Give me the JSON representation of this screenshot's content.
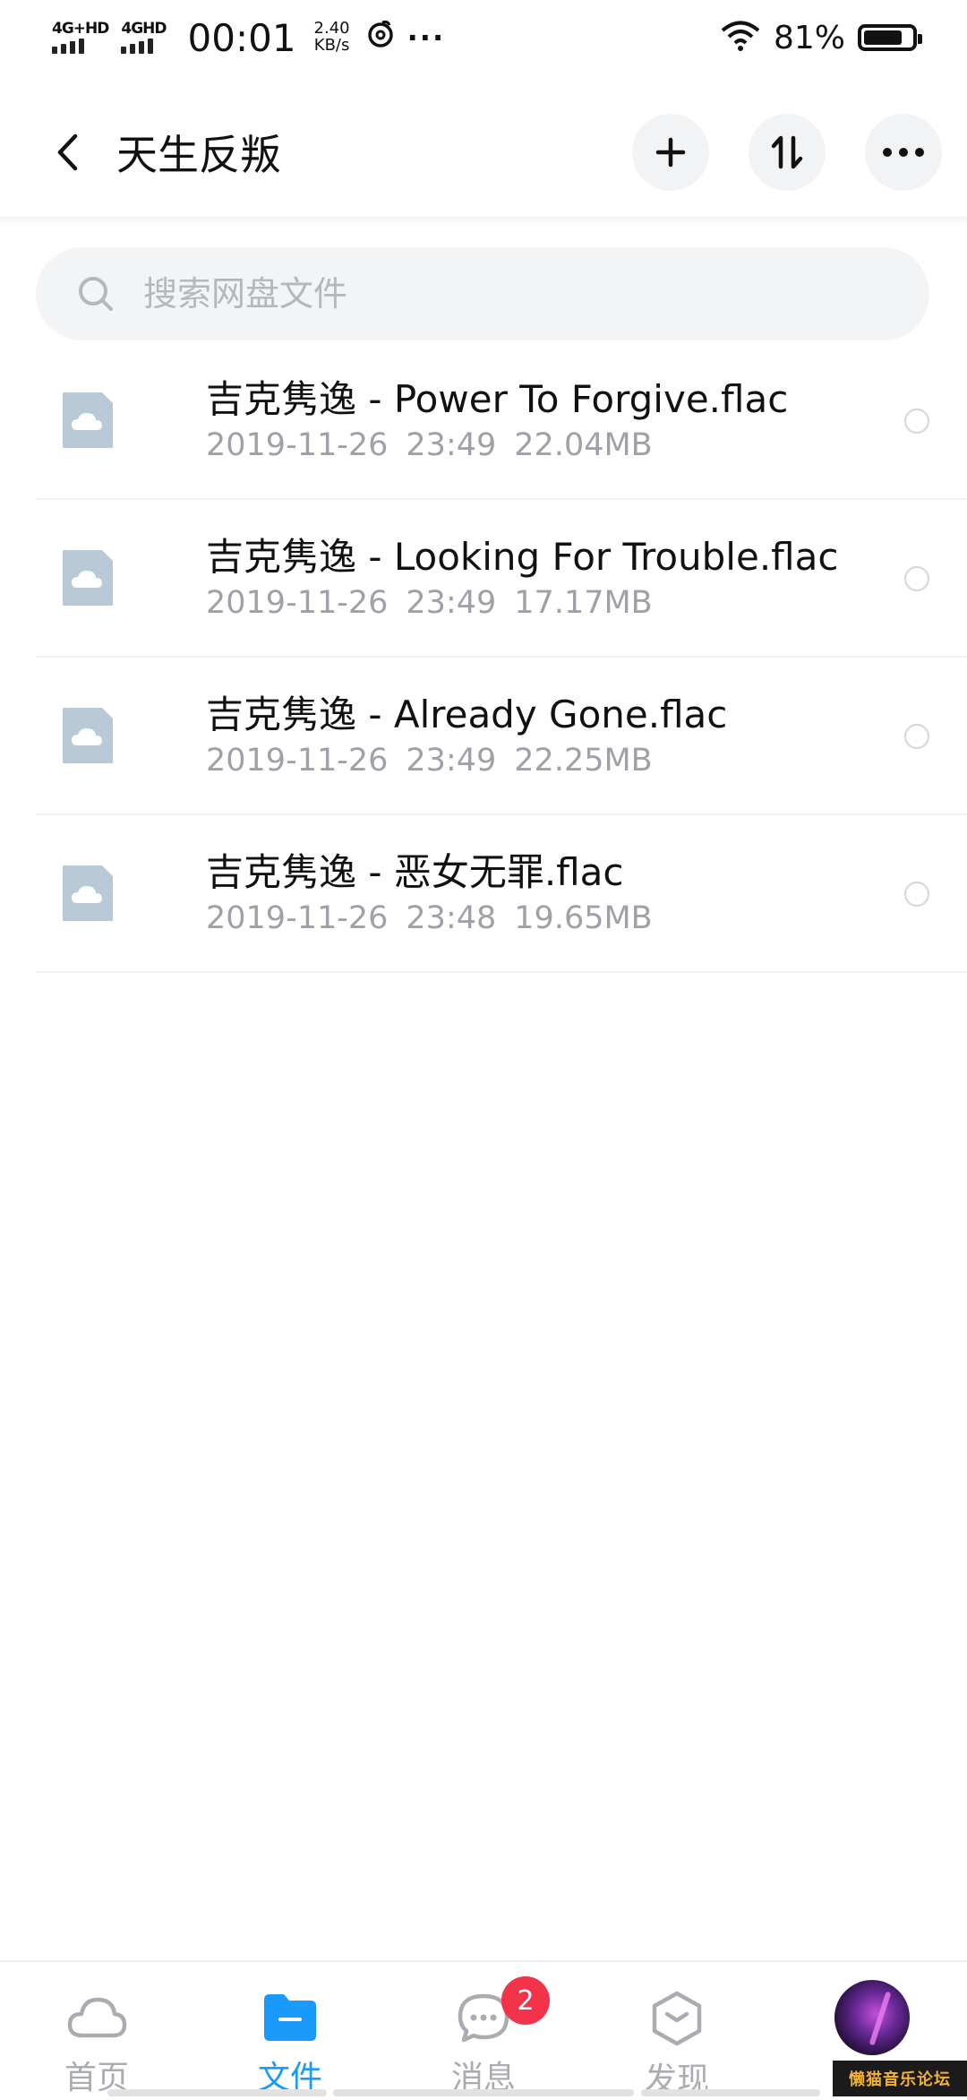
{
  "status_bar": {
    "network1": "4G+HD",
    "network2": "4GHD",
    "time": "00:01",
    "speed_value": "2.40",
    "speed_unit": "KB/s",
    "more": "···",
    "battery_pct": "81%",
    "battery_level": 0.81
  },
  "header": {
    "title": "天生反叛"
  },
  "search": {
    "placeholder": "搜索网盘文件"
  },
  "files": [
    {
      "name": "吉克隽逸 - Power To Forgive.flac",
      "date": "2019-11-26",
      "time": "23:49",
      "size": "22.04MB"
    },
    {
      "name": "吉克隽逸 - Looking For Trouble.flac",
      "date": "2019-11-26",
      "time": "23:49",
      "size": "17.17MB"
    },
    {
      "name": "吉克隽逸 - Already Gone.flac",
      "date": "2019-11-26",
      "time": "23:49",
      "size": "22.25MB"
    },
    {
      "name": "吉克隽逸 - 恶女无罪.flac",
      "date": "2019-11-26",
      "time": "23:48",
      "size": "19.65MB"
    }
  ],
  "bottom_nav": {
    "tabs": [
      {
        "label": "首页",
        "icon": "cloud-icon"
      },
      {
        "label": "文件",
        "icon": "folder-icon"
      },
      {
        "label": "消息",
        "icon": "message-icon"
      },
      {
        "label": "发现",
        "icon": "discover-icon"
      }
    ],
    "message_badge": "2",
    "active_tab": "文件",
    "active_color": "#1a9bfb"
  },
  "watermark": "懒猫音乐论坛"
}
